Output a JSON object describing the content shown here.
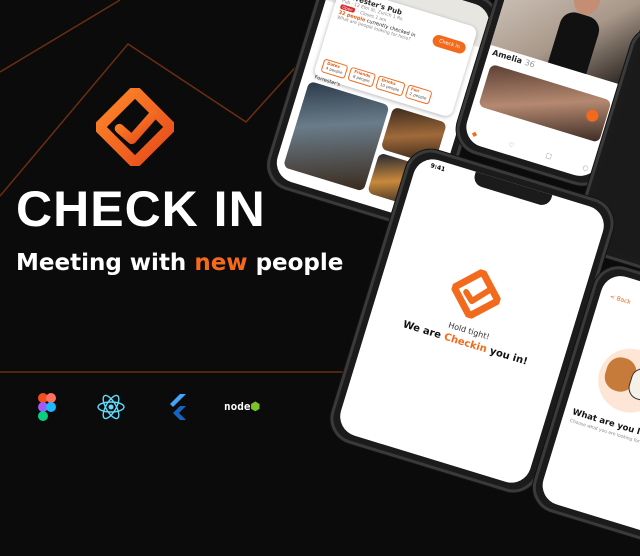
{
  "hero": {
    "title": "CHECK IN",
    "tagline_pre": "Meeting with ",
    "tagline_highlight": "new",
    "tagline_post": " people"
  },
  "tech_stack": {
    "icons": [
      "figma-icon",
      "react-icon",
      "flutter-icon",
      "nodejs-icon"
    ],
    "node_label": "node"
  },
  "colors": {
    "accent": "#f36a1d",
    "background": "#0b0b0b",
    "line": "#6b2e10"
  },
  "phone_venue": {
    "pub_name": "Forrester's Pub",
    "address": "Pub · 12 Elm St, Zurich 1 Rs.",
    "open_label": "Open",
    "hours": "· Closes 1 am",
    "people_count": "32 people",
    "people_suffix": "currently checked in",
    "prompt": "What are people looking for here?",
    "checkin_label": "Check in",
    "stats": [
      {
        "label": "Dates",
        "value": "4 people"
      },
      {
        "label": "Friends",
        "value": "8 people"
      },
      {
        "label": "Drinks",
        "value": "10 people"
      },
      {
        "label": "Fun",
        "value": "2 people"
      }
    ],
    "section_label": "Forrester's"
  },
  "phone_profile": {
    "name": "Amelia",
    "age": "36"
  },
  "phone_checking": {
    "time": "9:41",
    "hold_text": "Hold tight!",
    "checking_pre": "We are ",
    "checking_highlight": "Checkin",
    "checking_post": " you in!"
  },
  "phone_looking": {
    "back_label": "< Back",
    "question": "What are you looking for",
    "question_sub": "Choose what you are looking for today"
  }
}
